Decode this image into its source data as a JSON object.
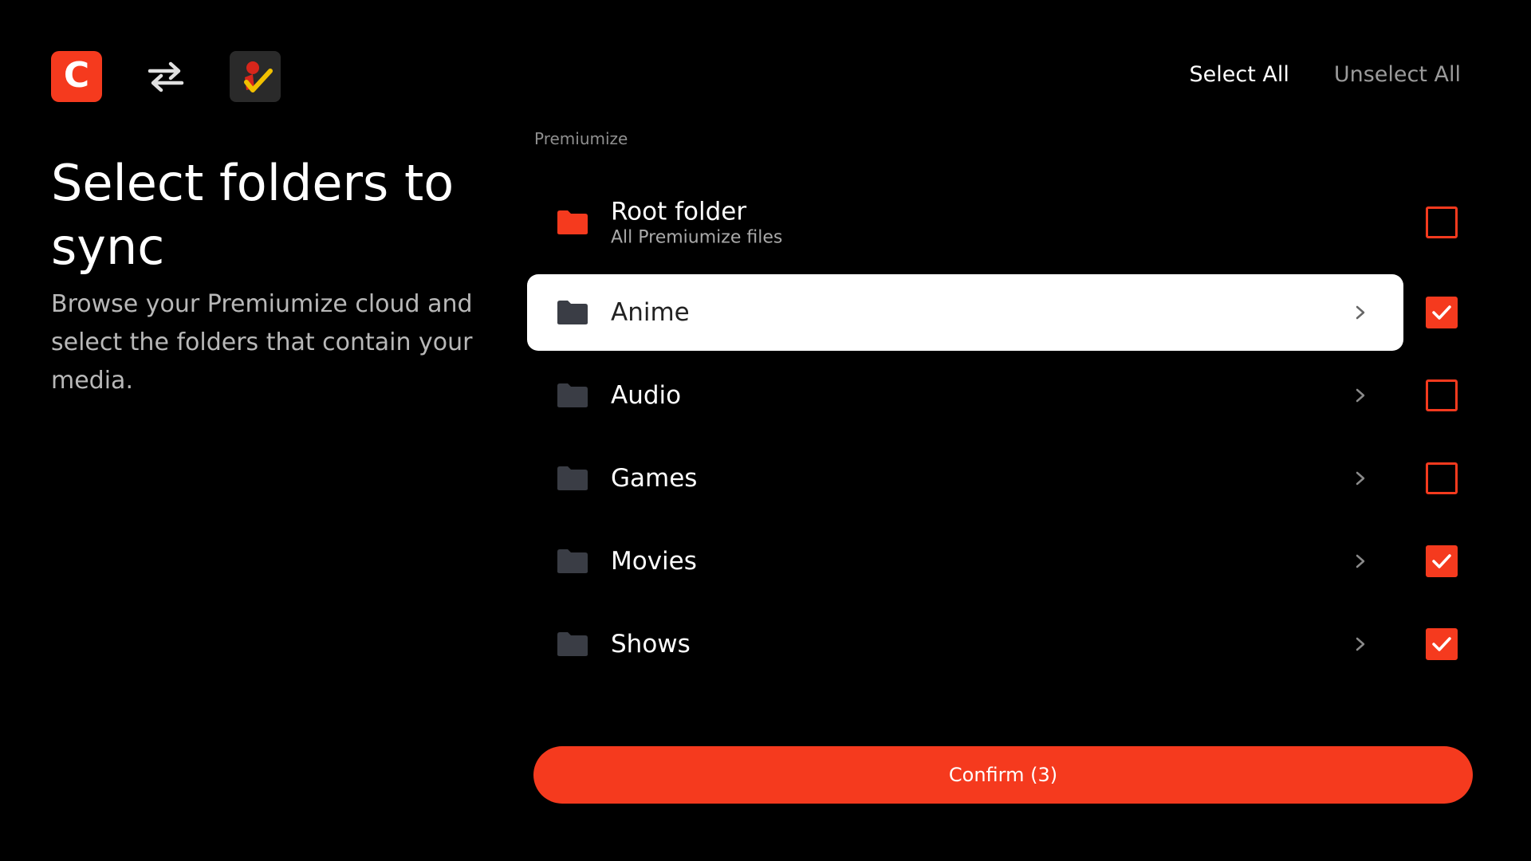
{
  "header": {
    "app_logo_letter": "C",
    "select_all_label": "Select All",
    "unselect_all_label": "Unselect All"
  },
  "intro": {
    "title": "Select folders to sync",
    "description": "Browse your Premiumize cloud and select the folders that contain your media."
  },
  "list": {
    "section_label": "Premiumize",
    "root": {
      "name": "Root folder",
      "subtitle": "All Premiumize files",
      "checked": false
    },
    "items": [
      {
        "name": "Anime",
        "checked": true,
        "focused": true
      },
      {
        "name": "Audio",
        "checked": false,
        "focused": false
      },
      {
        "name": "Games",
        "checked": false,
        "focused": false
      },
      {
        "name": "Movies",
        "checked": true,
        "focused": false
      },
      {
        "name": "Shows",
        "checked": true,
        "focused": false
      }
    ]
  },
  "confirm_label": "Confirm (3)",
  "colors": {
    "accent": "#f53a1e",
    "background": "#000000",
    "folder_dark": "#3a3d45"
  }
}
